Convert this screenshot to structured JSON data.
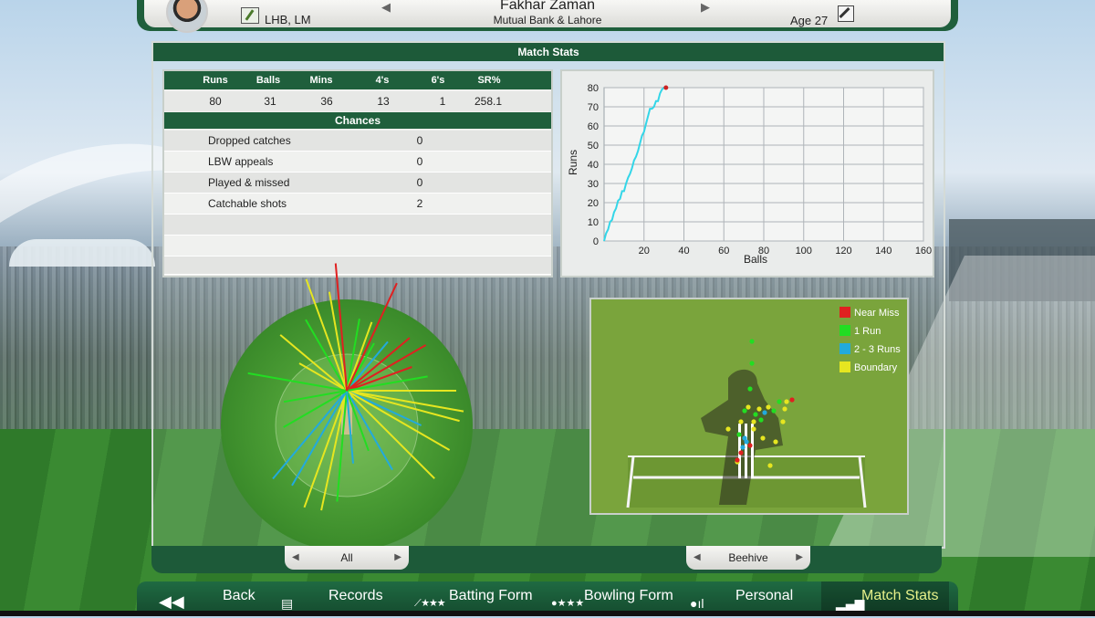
{
  "header": {
    "player_name": "Fakhar Zaman",
    "team": "Mutual Bank & Lahore",
    "batting_style": "LHB, LM",
    "age": "Age 27",
    "prev_arrow": "◀",
    "next_arrow": "▶"
  },
  "panel": {
    "title": "Match Stats"
  },
  "stats": {
    "headers": [
      "Runs",
      "Balls",
      "Mins",
      "4's",
      "6's",
      "SR%"
    ],
    "values": [
      "80",
      "31",
      "36",
      "13",
      "1",
      "258.1"
    ]
  },
  "chances": {
    "title": "Chances",
    "rows": [
      {
        "label": "Dropped catches",
        "value": "0"
      },
      {
        "label": "LBW appeals",
        "value": "0"
      },
      {
        "label": "Played & missed",
        "value": "0"
      },
      {
        "label": "Catchable shots",
        "value": "2"
      }
    ]
  },
  "chart_data": {
    "type": "line",
    "xlabel": "Balls",
    "ylabel": "Runs",
    "xlim": [
      0,
      160
    ],
    "ylim": [
      0,
      80
    ],
    "xticks": [
      20,
      40,
      60,
      80,
      100,
      120,
      140,
      160
    ],
    "yticks": [
      0,
      10,
      20,
      30,
      40,
      50,
      60,
      70,
      80
    ],
    "line_color": "#33d6e8",
    "end_marker_color": "#cc2222",
    "series": [
      {
        "x": [
          0,
          1,
          2,
          3,
          4,
          5,
          6,
          7,
          8,
          9,
          10,
          11,
          12,
          13,
          14,
          15,
          16,
          17,
          18,
          19,
          20,
          21,
          22,
          23,
          24,
          25,
          26,
          27,
          28,
          29,
          30,
          31
        ],
        "values": [
          0,
          4,
          6,
          10,
          11,
          15,
          17,
          21,
          22,
          26,
          26,
          30,
          33,
          35,
          38,
          42,
          44,
          47,
          51,
          55,
          57,
          61,
          65,
          69,
          69,
          70,
          73,
          73,
          77,
          79,
          80,
          80
        ]
      }
    ]
  },
  "legend": {
    "near_miss": "Near Miss",
    "one_run": "1 Run",
    "two_three_runs": "2 - 3 Runs",
    "boundary": "Boundary",
    "colors": {
      "near_miss": "#e02020",
      "one_run": "#22dd22",
      "two_three_runs": "#22aadd",
      "boundary": "#e6e620"
    }
  },
  "filters": {
    "left": "All",
    "right": "Beehive"
  },
  "nav": {
    "back": "Back",
    "records": "Records",
    "batting_form": "Batting Form",
    "bowling_form": "Bowling Form",
    "personal": "Personal",
    "match_stats": "Match Stats"
  }
}
